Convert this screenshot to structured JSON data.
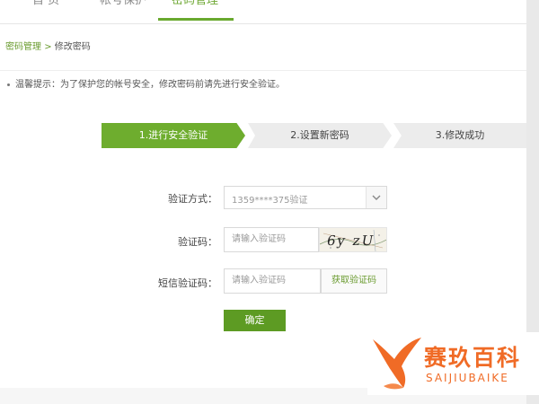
{
  "nav": {
    "items": [
      {
        "label": "首 页"
      },
      {
        "label": "帐号保护"
      },
      {
        "label": "密码管理"
      }
    ]
  },
  "breadcrumb": {
    "link": "密码管理",
    "separator": ">",
    "current": "修改密码"
  },
  "tip": "温馨提示：为了保护您的帐号安全，修改密码前请先进行安全验证。",
  "steps": [
    "1.进行安全验证",
    "2.设置新密码",
    "3.修改成功"
  ],
  "form": {
    "method_label": "验证方式：",
    "method_value": "1359****375验证",
    "captcha_label": "验证码：",
    "captcha_placeholder": "请输入验证码",
    "captcha_text": "6y zU",
    "sms_label": "短信验证码：",
    "sms_placeholder": "请输入验证码",
    "sms_button": "获取验证码",
    "submit": "确定"
  },
  "watermark": {
    "cn": "赛玖百科",
    "en": "SAIJIUBAIKE"
  },
  "colors": {
    "accent": "#6ead2e",
    "button": "#5d9b23",
    "watermark": "#f06b26"
  },
  "icons": {
    "dropdown": "chevron-down-icon",
    "logo": "whale-tail-icon"
  }
}
